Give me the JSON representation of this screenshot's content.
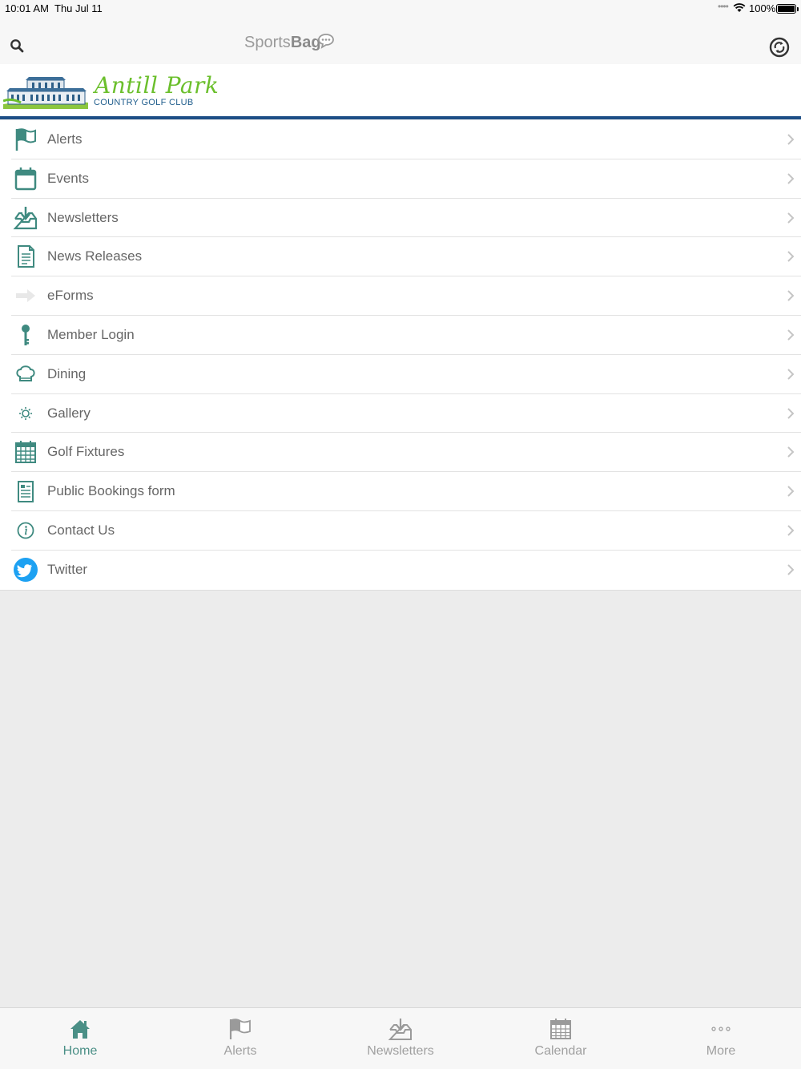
{
  "status_bar": {
    "time": "10:01 AM",
    "date": "Thu Jul 11",
    "signal": "••••",
    "battery": "100%"
  },
  "nav": {
    "brand_light": "Sports",
    "brand_bold": "Bag"
  },
  "logo": {
    "name": "Antill Park",
    "subtitle": "COUNTRY GOLF CLUB"
  },
  "menu": {
    "items": [
      {
        "label": "Alerts",
        "icon": "flag-icon"
      },
      {
        "label": "Events",
        "icon": "calendar-icon"
      },
      {
        "label": "Newsletters",
        "icon": "inbox-download-icon"
      },
      {
        "label": "News Releases",
        "icon": "document-icon"
      },
      {
        "label": "eForms",
        "icon": "arrow-right-icon"
      },
      {
        "label": "Member Login",
        "icon": "key-icon"
      },
      {
        "label": "Dining",
        "icon": "chef-hat-icon"
      },
      {
        "label": "Gallery",
        "icon": "sun-icon"
      },
      {
        "label": "Golf Fixtures",
        "icon": "calendar-grid-icon"
      },
      {
        "label": "Public Bookings form",
        "icon": "form-icon"
      },
      {
        "label": "Contact Us",
        "icon": "info-icon"
      },
      {
        "label": "Twitter",
        "icon": "twitter-icon"
      }
    ]
  },
  "tabs": [
    {
      "label": "Home",
      "icon": "home-icon",
      "active": true
    },
    {
      "label": "Alerts",
      "icon": "flag-icon",
      "active": false
    },
    {
      "label": "Newsletters",
      "icon": "inbox-download-icon",
      "active": false
    },
    {
      "label": "Calendar",
      "icon": "calendar-grid-icon",
      "active": false
    },
    {
      "label": "More",
      "icon": "more-dots-icon",
      "active": false
    }
  ],
  "colors": {
    "accent": "#3f8a80",
    "header_line": "#1d4e86",
    "logo_green": "#6bbf2c",
    "twitter": "#1da1f2"
  }
}
